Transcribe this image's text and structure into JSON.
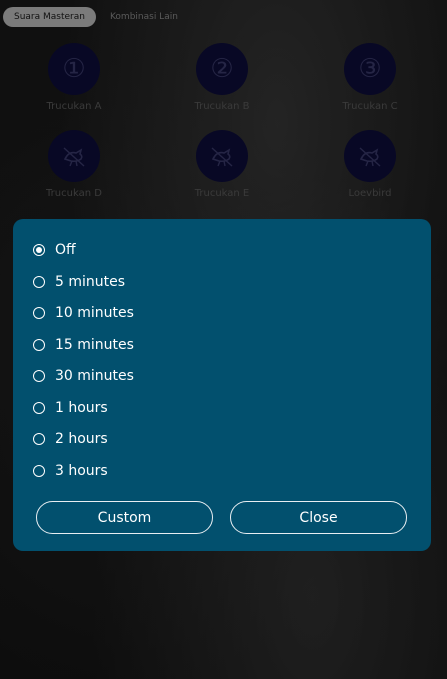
{
  "tabs": [
    {
      "label": "Suara Masteran",
      "active": true
    },
    {
      "label": "Kombinasi Lain",
      "active": false
    }
  ],
  "sounds": [
    {
      "label": "Trucukan A",
      "icon": "number-1-icon",
      "glyph": "①"
    },
    {
      "label": "Trucukan B",
      "icon": "number-2-icon",
      "glyph": "②"
    },
    {
      "label": "Trucukan C",
      "icon": "number-3-icon",
      "glyph": "③"
    },
    {
      "label": "Trucukan D",
      "icon": "bird-icon"
    },
    {
      "label": "Trucukan E",
      "icon": "bird-icon"
    },
    {
      "label": "Loevbird",
      "icon": "bird-icon"
    }
  ],
  "timer_dialog": {
    "options": [
      {
        "label": "Off",
        "selected": true
      },
      {
        "label": "5 minutes",
        "selected": false
      },
      {
        "label": "10 minutes",
        "selected": false
      },
      {
        "label": "15 minutes",
        "selected": false
      },
      {
        "label": "30 minutes",
        "selected": false
      },
      {
        "label": "1 hours",
        "selected": false
      },
      {
        "label": "2 hours",
        "selected": false
      },
      {
        "label": "3 hours",
        "selected": false
      }
    ],
    "custom_label": "Custom",
    "close_label": "Close"
  },
  "colors": {
    "dialog_bg": "#02506e",
    "circle_bg": "#0d0d3a",
    "active_tab_bg": "#bdbdbd"
  }
}
